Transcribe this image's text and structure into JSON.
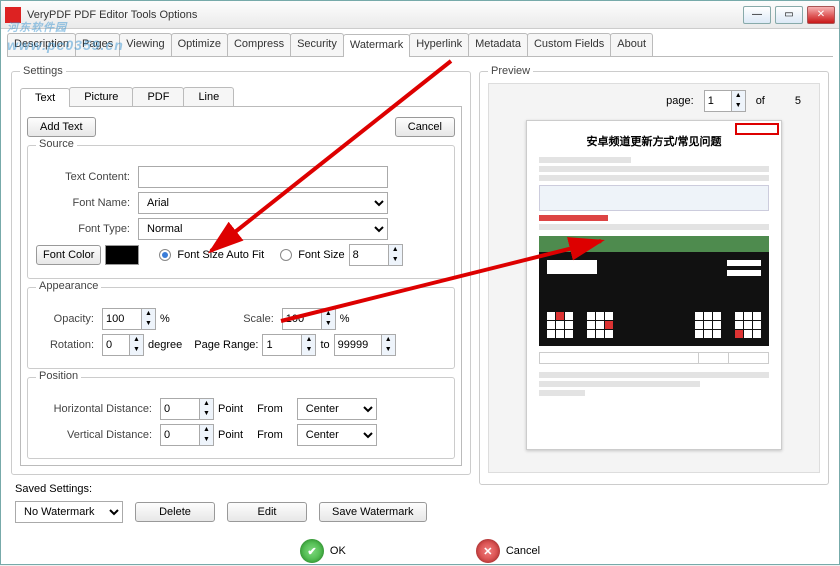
{
  "window": {
    "title": "VeryPDF PDF Editor Tools Options"
  },
  "maintabs": [
    "Description",
    "Pages",
    "Viewing",
    "Optimize",
    "Compress",
    "Security",
    "Watermark",
    "Hyperlink",
    "Metadata",
    "Custom Fields",
    "About"
  ],
  "maintab_active": 6,
  "settings": {
    "legend": "Settings",
    "tabs": [
      "Text",
      "Picture",
      "PDF",
      "Line"
    ],
    "tab_active": 0,
    "add_text": "Add Text",
    "cancel": "Cancel",
    "source": {
      "legend": "Source",
      "text_content_label": "Text Content:",
      "text_content": "",
      "font_name_label": "Font Name:",
      "font_name": "Arial",
      "font_type_label": "Font Type:",
      "font_type": "Normal",
      "font_color_label": "Font Color",
      "font_color": "#000000",
      "auto_fit_label": "Font Size Auto Fit",
      "font_size_label": "Font Size",
      "font_size": "8",
      "size_mode": "auto"
    },
    "appearance": {
      "legend": "Appearance",
      "opacity_label": "Opacity:",
      "opacity": "100",
      "opacity_unit": "%",
      "scale_label": "Scale:",
      "scale": "100",
      "scale_unit": "%",
      "rotation_label": "Rotation:",
      "rotation": "0",
      "rotation_unit": "degree",
      "page_range_label": "Page Range:",
      "page_from": "1",
      "to_label": "to",
      "page_to": "99999"
    },
    "position": {
      "legend": "Position",
      "h_label": "Horizontal Distance:",
      "h_value": "0",
      "v_label": "Vertical Distance:",
      "v_value": "0",
      "unit_label": "Point",
      "from_label": "From",
      "h_from": "Center",
      "v_from": "Center"
    }
  },
  "saved": {
    "label": "Saved Settings:",
    "selected": "No Watermark",
    "delete": "Delete",
    "edit": "Edit",
    "save": "Save Watermark"
  },
  "preview": {
    "legend": "Preview",
    "page_label": "page:",
    "page": "1",
    "of_label": "of",
    "total": "5",
    "doc_title": "安卓频道更新方式/常见问题"
  },
  "bottom": {
    "ok": "OK",
    "cancel": "Cancel"
  },
  "site_overlay": {
    "name": "河东软件园",
    "url": "www.pc0359.cn"
  }
}
